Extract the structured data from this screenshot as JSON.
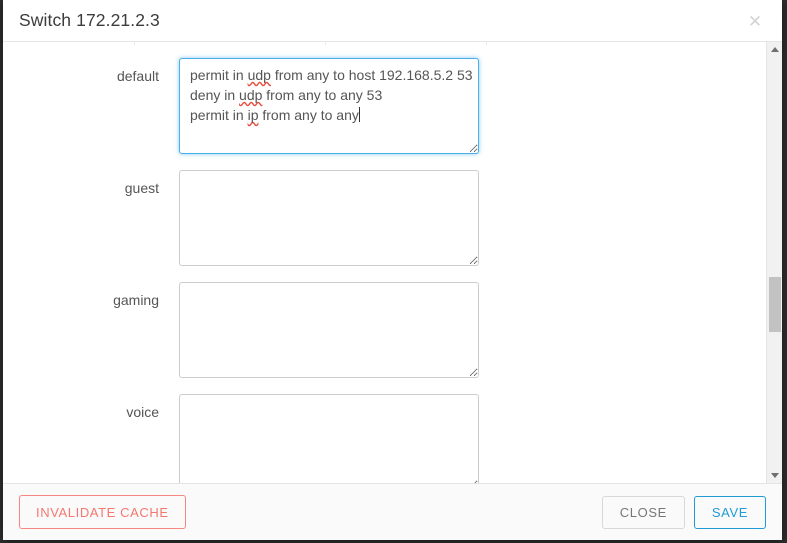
{
  "window": {
    "title": "Switch 172.21.2.3",
    "close_icon": "close-x-icon"
  },
  "acl_rows": [
    {
      "label": "",
      "value": "",
      "focused": false,
      "partial_top": true
    },
    {
      "label": "default",
      "value": "permit in udp from any to host 192.168.5.2 53\ndeny in udp from any to any 53\npermit in ip from any to any",
      "lines": [
        [
          {
            "t": "permit in ",
            "spell": false
          },
          {
            "t": "udp",
            "spell": true
          },
          {
            "t": " from any to host 192.168.5.2 53",
            "spell": false
          }
        ],
        [
          {
            "t": "deny in ",
            "spell": false
          },
          {
            "t": "udp",
            "spell": true
          },
          {
            "t": " from any to any 53",
            "spell": false
          }
        ],
        [
          {
            "t": "permit in ",
            "spell": false
          },
          {
            "t": "ip",
            "spell": true
          },
          {
            "t": " from any to any",
            "spell": false
          }
        ]
      ],
      "focused": true,
      "caret": true
    },
    {
      "label": "guest",
      "value": "",
      "focused": false
    },
    {
      "label": "gaming",
      "value": "",
      "focused": false
    },
    {
      "label": "voice",
      "value": "",
      "focused": false
    }
  ],
  "scrollbar": {
    "up_arrow_icon": "scroll-up-arrow-icon",
    "down_arrow_icon": "scroll-down-arrow-icon",
    "thumb_position_percent": 62
  },
  "footer": {
    "invalidate_cache_label": "INVALIDATE CACHE",
    "close_label": "CLOSE",
    "save_label": "SAVE"
  },
  "colors": {
    "accent_blue": "#1f9bd6",
    "focus_blue": "#4aaee8",
    "danger_red": "#f4786f",
    "text_gray": "#555555",
    "title_gray": "#3c3c3c",
    "spellcheck_red": "#e74c3c"
  }
}
